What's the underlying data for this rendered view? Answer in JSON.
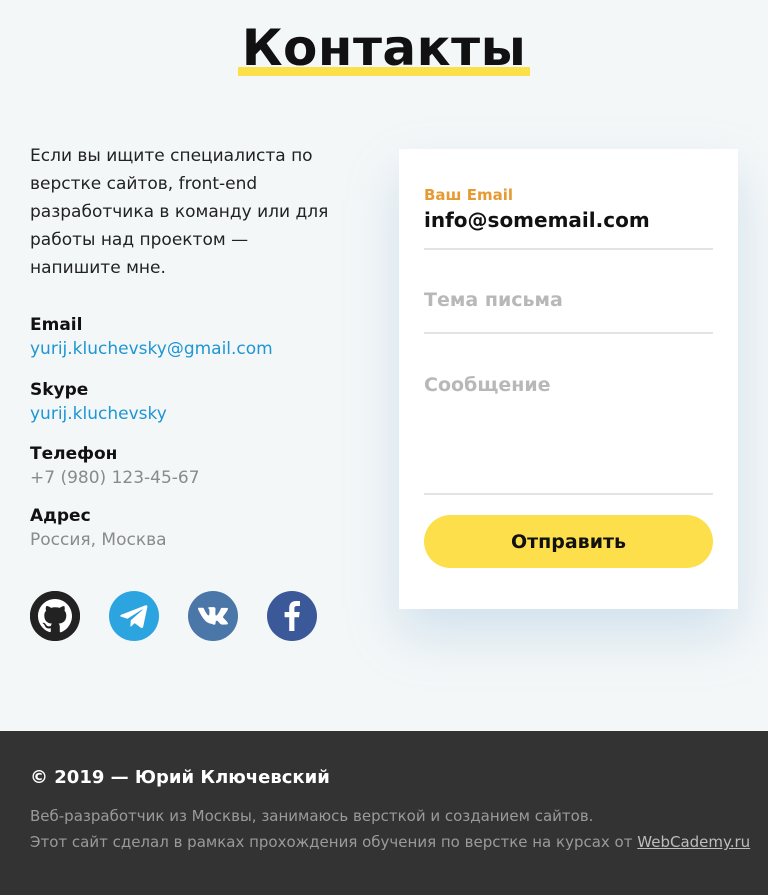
{
  "page": {
    "title": "Контакты"
  },
  "intro": "Если вы ищите специалиста по верстке сайтов, front-end разработчика в команду или для работы над проектом — напишите мне.",
  "contacts": {
    "email": {
      "label": "Email",
      "value": "yurij.kluchevsky@gmail.com"
    },
    "skype": {
      "label": "Skype",
      "value": "yurij.kluchevsky"
    },
    "phone": {
      "label": "Телефон",
      "value": "+7 (980) 123-45-67"
    },
    "address": {
      "label": "Адрес",
      "value": "Россия, Москва"
    }
  },
  "socials": [
    {
      "name": "github-icon",
      "color": "#222222"
    },
    {
      "name": "telegram-icon",
      "color": "#2ba4e0"
    },
    {
      "name": "vk-icon",
      "color": "#4a76a8"
    },
    {
      "name": "facebook-icon",
      "color": "#3b5998"
    }
  ],
  "form": {
    "email_label": "Ваш Email",
    "email_value": "info@somemail.com",
    "subject_placeholder": "Тема письма",
    "message_placeholder": "Сообщение",
    "submit_label": "Отправить"
  },
  "footer": {
    "copyright": "© 2019 — Юрий Ключевский",
    "line1": "Веб-разработчик из Москвы, занимаюсь версткой и созданием сайтов.",
    "line2_prefix": "Этот сайт сделал в рамках прохождения обучения по верстке на курсах от",
    "link": "WebCademy.ru"
  },
  "colors": {
    "accent": "#fddf4c",
    "link": "#1e96d4",
    "label_orange": "#e89a32",
    "footer_bg": "#333333"
  }
}
